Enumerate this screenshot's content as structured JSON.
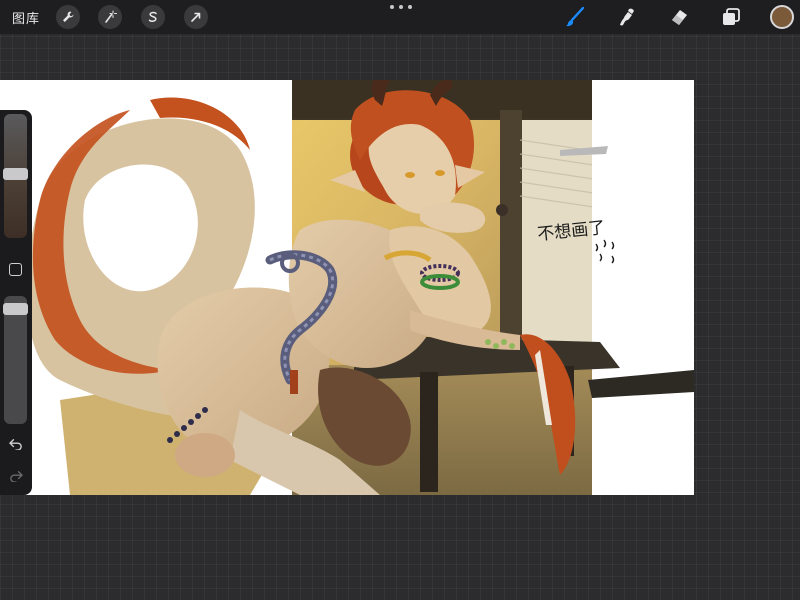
{
  "toolbar": {
    "gallery_label": "图库",
    "actions": [
      {
        "name": "actions-wrench-icon"
      },
      {
        "name": "adjustments-wand-icon"
      },
      {
        "name": "selection-icon"
      },
      {
        "name": "transform-arrow-icon"
      }
    ],
    "right_tools": [
      {
        "name": "brush-icon",
        "active": true
      },
      {
        "name": "smudge-icon",
        "active": false
      },
      {
        "name": "eraser-icon",
        "active": false
      },
      {
        "name": "layers-icon",
        "active": false
      }
    ],
    "current_color": "#7b5a3a",
    "accent_color": "#1a8cff"
  },
  "canvas": {
    "handwritten_text": "不想画了",
    "background": "#ffffff"
  },
  "sidebar": {
    "brush_size_level": 0.48,
    "opacity_level": 0.06,
    "icons": [
      "modify-square-icon",
      "undo-icon",
      "redo-icon"
    ]
  }
}
